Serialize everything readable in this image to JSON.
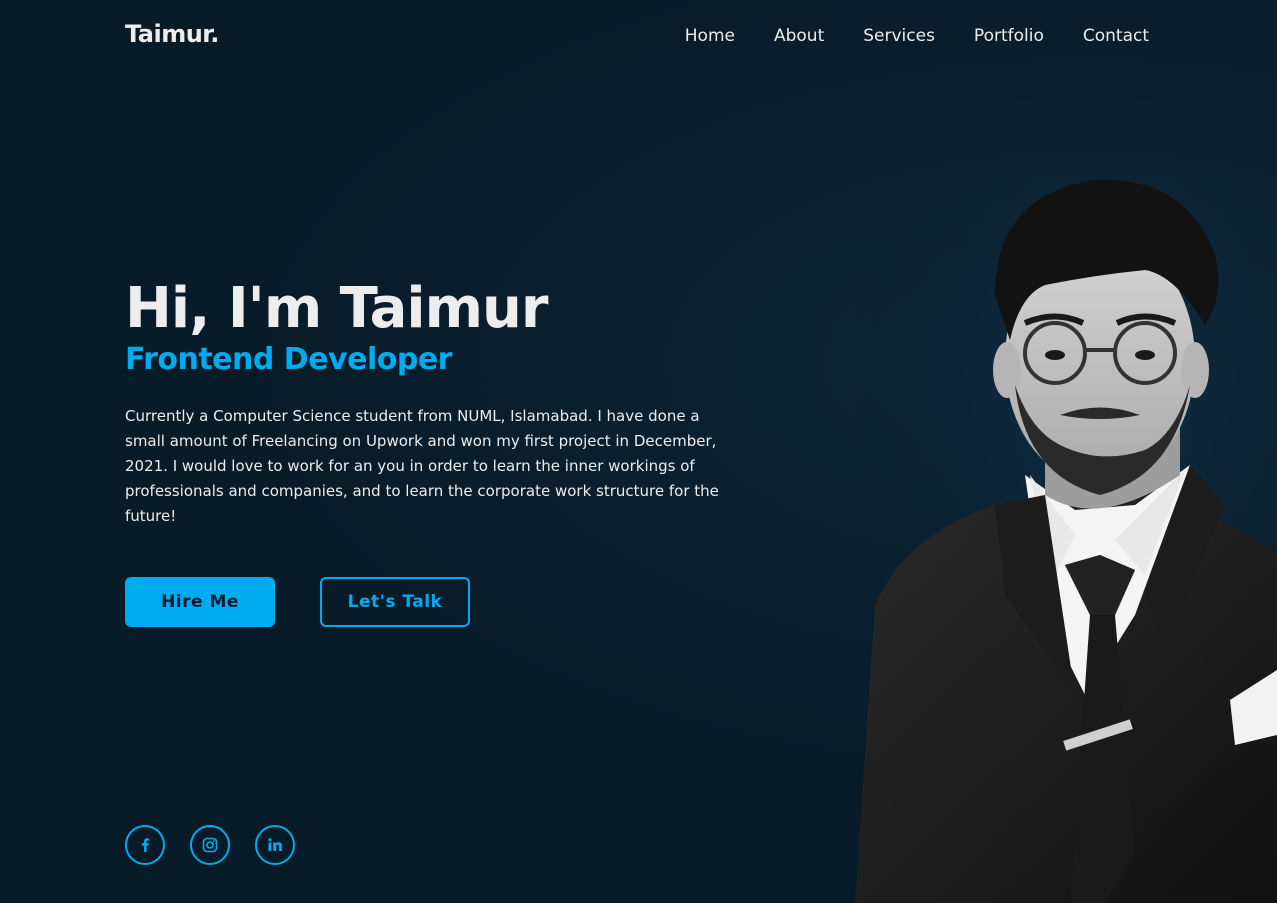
{
  "brand": {
    "logo": "Taimur."
  },
  "nav": {
    "items": [
      "Home",
      "About",
      "Services",
      "Portfolio",
      "Contact"
    ]
  },
  "hero": {
    "title": "Hi, I'm Taimur",
    "subtitle": "Frontend Developer",
    "description": "Currently a Computer Science student from NUML, Islamabad. I have done a small amount of Freelancing on Upwork and won my first project in December, 2021. I would love to work for an you in order to learn the inner workings of professionals and companies, and to learn the corporate work structure for the future!",
    "primary_button": "Hire Me",
    "secondary_button": "Let's Talk"
  },
  "socials": [
    {
      "icon": "facebook-icon",
      "glyph": "f"
    },
    {
      "icon": "instagram-icon",
      "glyph": ""
    },
    {
      "icon": "linkedin-icon",
      "glyph": "in"
    }
  ],
  "colors": {
    "background": "#081b29",
    "accent": "#00abf0",
    "text": "#ededed"
  }
}
